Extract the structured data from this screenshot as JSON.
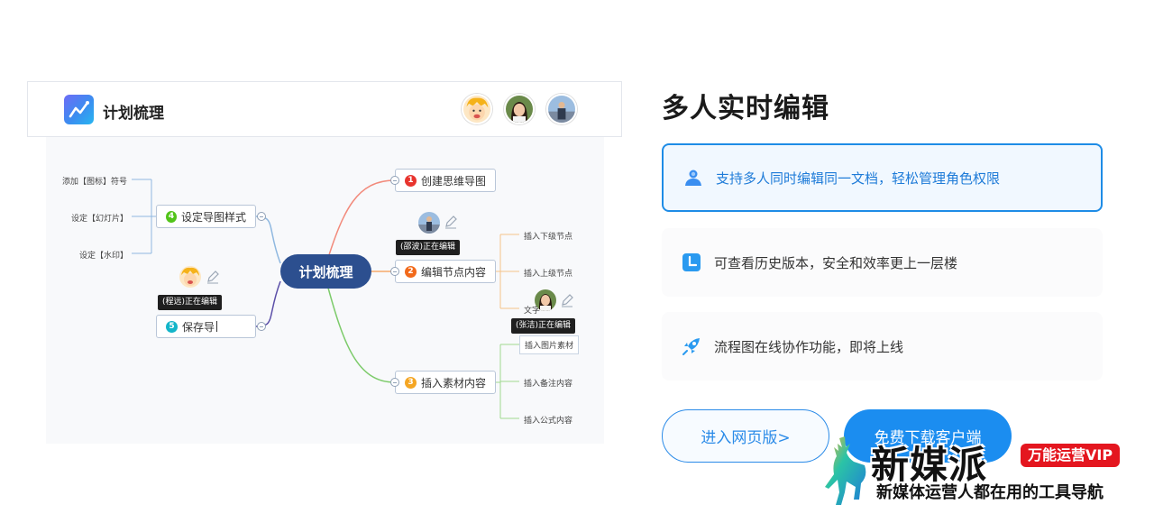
{
  "app": {
    "title": "计划梳理",
    "avatars": [
      "avatar-cartoon-boy",
      "avatar-woman",
      "avatar-man"
    ]
  },
  "mindmap": {
    "root": "计划梳理",
    "nodes": [
      {
        "num": "1",
        "label": "创建思维导图",
        "color": "#e8342e"
      },
      {
        "num": "2",
        "label": "编辑节点内容",
        "color": "#f26a1b"
      },
      {
        "num": "3",
        "label": "插入素材内容",
        "color": "#f5a623"
      },
      {
        "num": "4",
        "label": "设定导图样式",
        "color": "#52c41a"
      },
      {
        "num": "5",
        "label": "保存导",
        "color": "#13b5c9"
      }
    ],
    "leaves_left": [
      "添加【图标】符号",
      "设定【幻灯片】",
      "设定【水印】"
    ],
    "leaves_edit": [
      "插入下级节点",
      "插入上级节点",
      "文字"
    ],
    "leaves_insert": [
      "插入图片素材",
      "插入备注内容",
      "插入公式内容"
    ],
    "editing_tags": [
      "(邵波)正在编辑",
      "(程远)正在编辑",
      "(张洁)正在编辑"
    ]
  },
  "features": {
    "title": "多人实时编辑",
    "items": [
      {
        "text": "支持多人同时编辑同一文档，轻松管理角色权限",
        "icon": "users-icon"
      },
      {
        "text": "可查看历史版本，安全和效率更上一层楼",
        "icon": "history-icon"
      },
      {
        "text": "流程图在线协作功能，即将上线",
        "icon": "rocket-icon"
      }
    ],
    "btn_web": "进入网页版>",
    "btn_download": "免费下载客户端"
  },
  "watermark": {
    "brand": "新媒派",
    "badge": "万能运营VIP",
    "slogan": "新媒体运营人都在用的工具导航"
  },
  "colors": {
    "accent": "#1e8ce6",
    "root": "#2c4f8f"
  }
}
